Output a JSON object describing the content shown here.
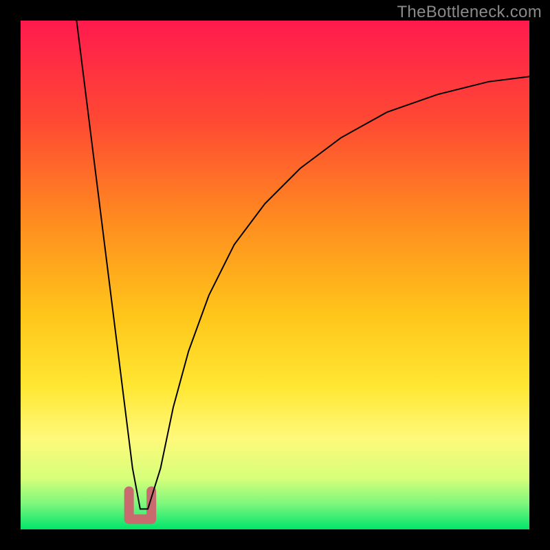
{
  "watermark": "TheBottleneck.com",
  "chart_data": {
    "type": "line",
    "title": "",
    "xlabel": "",
    "ylabel": "",
    "xlim": [
      0,
      100
    ],
    "ylim": [
      0,
      100
    ],
    "background_gradient": {
      "stops": [
        {
          "offset": 0.0,
          "color": "#ff1a4e"
        },
        {
          "offset": 0.2,
          "color": "#ff4a33"
        },
        {
          "offset": 0.4,
          "color": "#ff8e1f"
        },
        {
          "offset": 0.58,
          "color": "#ffc61a"
        },
        {
          "offset": 0.72,
          "color": "#ffe733"
        },
        {
          "offset": 0.82,
          "color": "#fff97a"
        },
        {
          "offset": 0.9,
          "color": "#d6ff7a"
        },
        {
          "offset": 0.95,
          "color": "#7cf77c"
        },
        {
          "offset": 1.0,
          "color": "#00e56b"
        }
      ]
    },
    "series": [
      {
        "name": "bottleneck-curve",
        "stroke": "#000000",
        "stroke_width": 2,
        "x": [
          11,
          13,
          15,
          17,
          19,
          20.5,
          22,
          23.5,
          25,
          27.5,
          30,
          33,
          37,
          42,
          48,
          55,
          63,
          72,
          82,
          92,
          100
        ],
        "values": [
          100,
          84,
          68,
          52,
          36,
          24,
          12,
          4,
          4,
          12,
          24,
          35,
          46,
          56,
          64,
          71,
          77,
          82,
          85.5,
          88,
          89
        ]
      }
    ],
    "marker": {
      "name": "minimum-bracket-marker",
      "stroke": "#c86a6e",
      "stroke_width": 14,
      "x": [
        21.3,
        21.3,
        25.7,
        25.7
      ],
      "values": [
        7.5,
        2,
        2,
        7.5
      ]
    }
  }
}
